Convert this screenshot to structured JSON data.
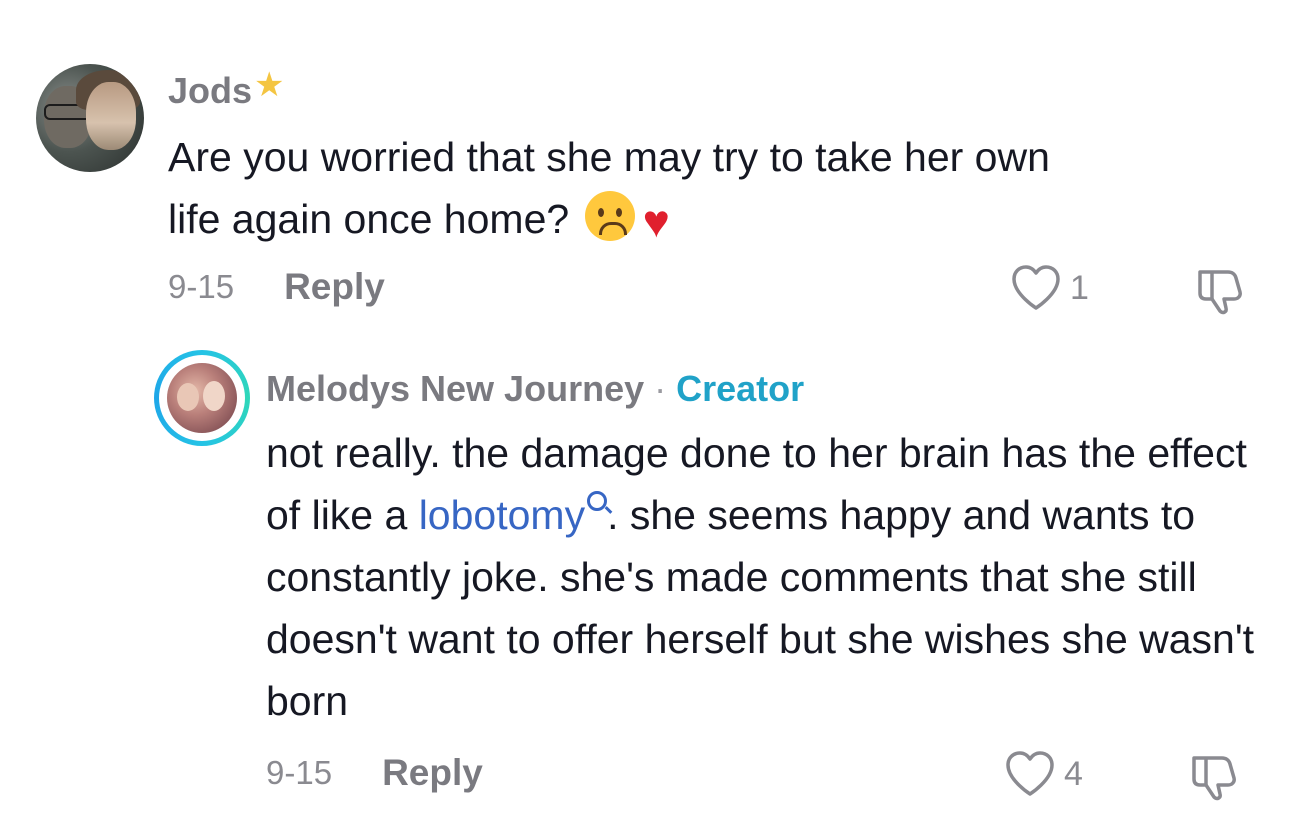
{
  "comments": [
    {
      "username": "Jods",
      "text_line1": "Are you worried that she may try to take her own",
      "text_line2": "life again once home?",
      "date": "9-15",
      "reply_label": "Reply",
      "likes": "1"
    },
    {
      "username": "Melodys New Journey",
      "dot": "·",
      "badge": "Creator",
      "text_before_link": "not really. the damage done to her brain has the effect of like a ",
      "link_text": "lobotomy",
      "text_after_link": ". she seems happy and wants to constantly joke. she's made comments that she still doesn't want to offer herself but she wishes she wasn't born",
      "date": "9-15",
      "reply_label": "Reply",
      "likes": "4"
    }
  ],
  "icons": {
    "star": "star-icon",
    "heart_outline": "heart-outline-icon",
    "dislike": "thumbs-down-icon",
    "search": "search-icon"
  },
  "colors": {
    "creator_badge": "#20a2c8",
    "link": "#3766c4",
    "muted": "#7a7a80"
  }
}
